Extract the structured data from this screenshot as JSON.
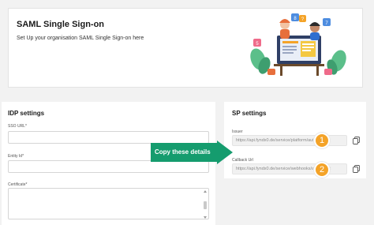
{
  "header": {
    "title": "SAML Single Sign-on",
    "subtitle": "Set Up your organisation SAML Single Sign-on here",
    "illustration_badges": [
      "8",
      "7",
      "5",
      "?"
    ]
  },
  "idp": {
    "title": "IDP settings",
    "sso_url_label": "SSO URL*",
    "sso_url_value": "",
    "entity_id_label": "Entity Id*",
    "entity_id_value": "",
    "certificate_label": "Certificate*",
    "certificate_value": ""
  },
  "sp": {
    "title": "SP settings",
    "issuer_label": "Issuer",
    "issuer_value": "https://api.fyndx0.de/service/platform/authorizat",
    "callback_label": "Callback Url",
    "callback_value": "https://api.fyndx0.de/service/webhooks/authorizat"
  },
  "callout": {
    "text": "Copy these details"
  },
  "badges": [
    "1",
    "2"
  ],
  "colors": {
    "callout": "#159c6e",
    "badge": "#f4a328",
    "background": "#f2f2f2"
  }
}
